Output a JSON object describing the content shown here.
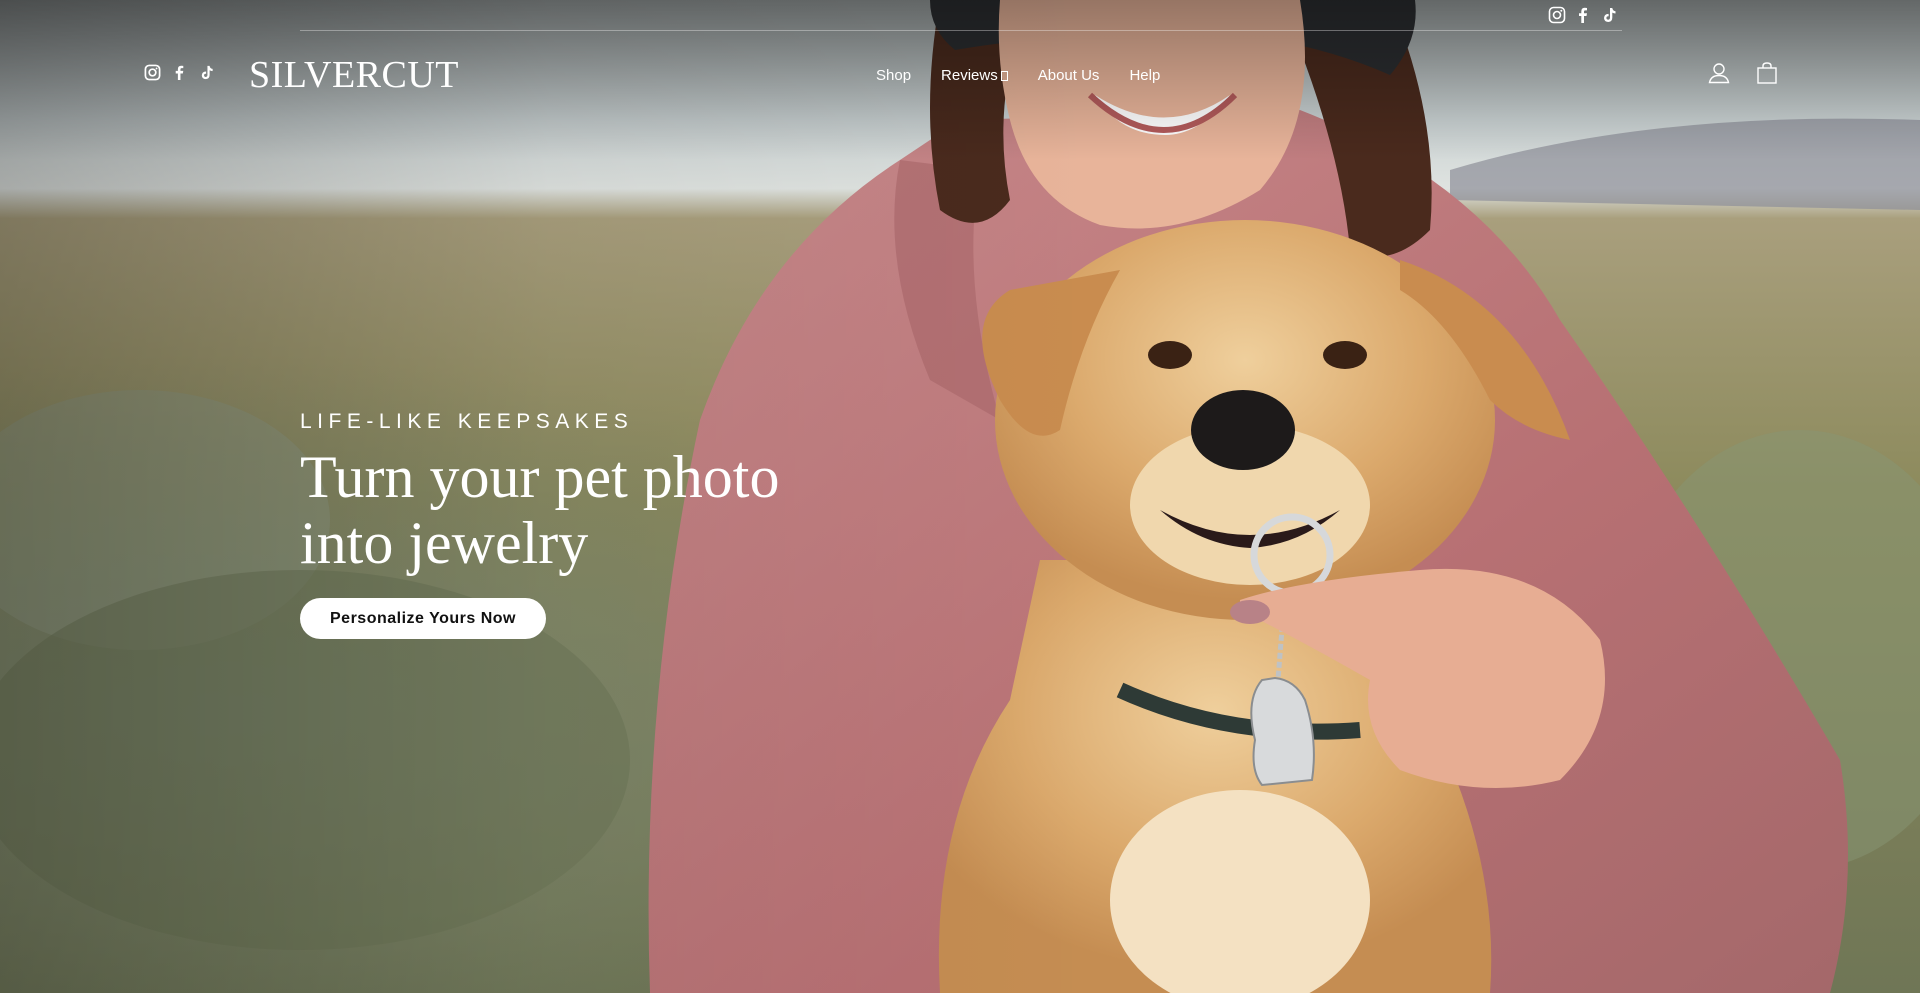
{
  "brand": {
    "logo_text": "SILVERCUT"
  },
  "topbar": {
    "social": [
      {
        "icon": "instagram-icon"
      },
      {
        "icon": "facebook-icon"
      },
      {
        "icon": "tiktok-icon"
      }
    ]
  },
  "header": {
    "social": [
      {
        "icon": "instagram-icon"
      },
      {
        "icon": "facebook-icon"
      },
      {
        "icon": "tiktok-icon"
      }
    ],
    "nav": {
      "shop": "Shop",
      "reviews": "Reviews",
      "about": "About Us",
      "help": "Help"
    },
    "actions": {
      "account_icon": "user-icon",
      "cart_icon": "shopping-bag-icon"
    }
  },
  "hero": {
    "eyebrow": "LIFE-LIKE KEEPSAKES",
    "headline_line1": "Turn your pet photo",
    "headline_line2": "into jewelry",
    "cta_label": "Personalize Yours Now"
  },
  "colors": {
    "text": "#ffffff",
    "cta_bg": "#ffffff",
    "cta_text": "#111111"
  }
}
